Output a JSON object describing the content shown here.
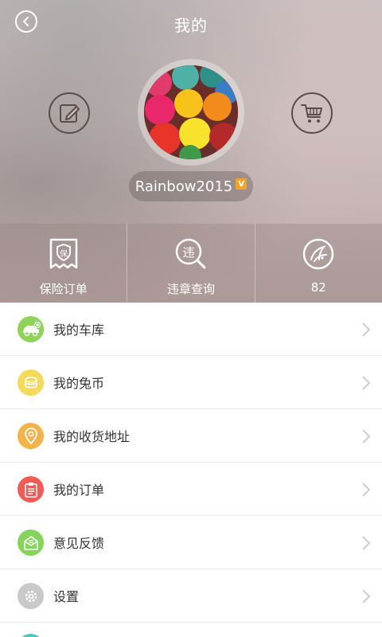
{
  "header": {
    "title": "我的",
    "username": "Rainbow2015",
    "vip_badge": "V"
  },
  "icons": {
    "back": "back-arrow-icon",
    "edit": "edit-pencil-icon",
    "cart": "shopping-cart-icon",
    "avatar": "yarn-balls-avatar"
  },
  "quick_actions": [
    {
      "label": "保险订单",
      "icon": "insurance-order-icon"
    },
    {
      "label": "违章查询",
      "icon": "violation-search-icon"
    },
    {
      "label": "82",
      "icon": "rabbit-coin-icon"
    }
  ],
  "menu": [
    {
      "label": "我的车库",
      "icon": "car-garage-icon",
      "color": "#8fd35a"
    },
    {
      "label": "我的兔币",
      "icon": "coin-stack-icon",
      "color": "#f5d95a"
    },
    {
      "label": "我的收货地址",
      "icon": "location-pin-icon",
      "color": "#f3b24a"
    },
    {
      "label": "我的订单",
      "icon": "clipboard-icon",
      "color": "#f15a55"
    },
    {
      "label": "意见反馈",
      "icon": "feedback-icon",
      "color": "#86d35e"
    },
    {
      "label": "设置",
      "icon": "gear-icon",
      "color": "#c9c9c9"
    }
  ],
  "colors": {
    "menu_text": "#333333",
    "divider": "#ececec",
    "icon_stroke": "#5b4c4c",
    "vip": "#f0a626"
  }
}
